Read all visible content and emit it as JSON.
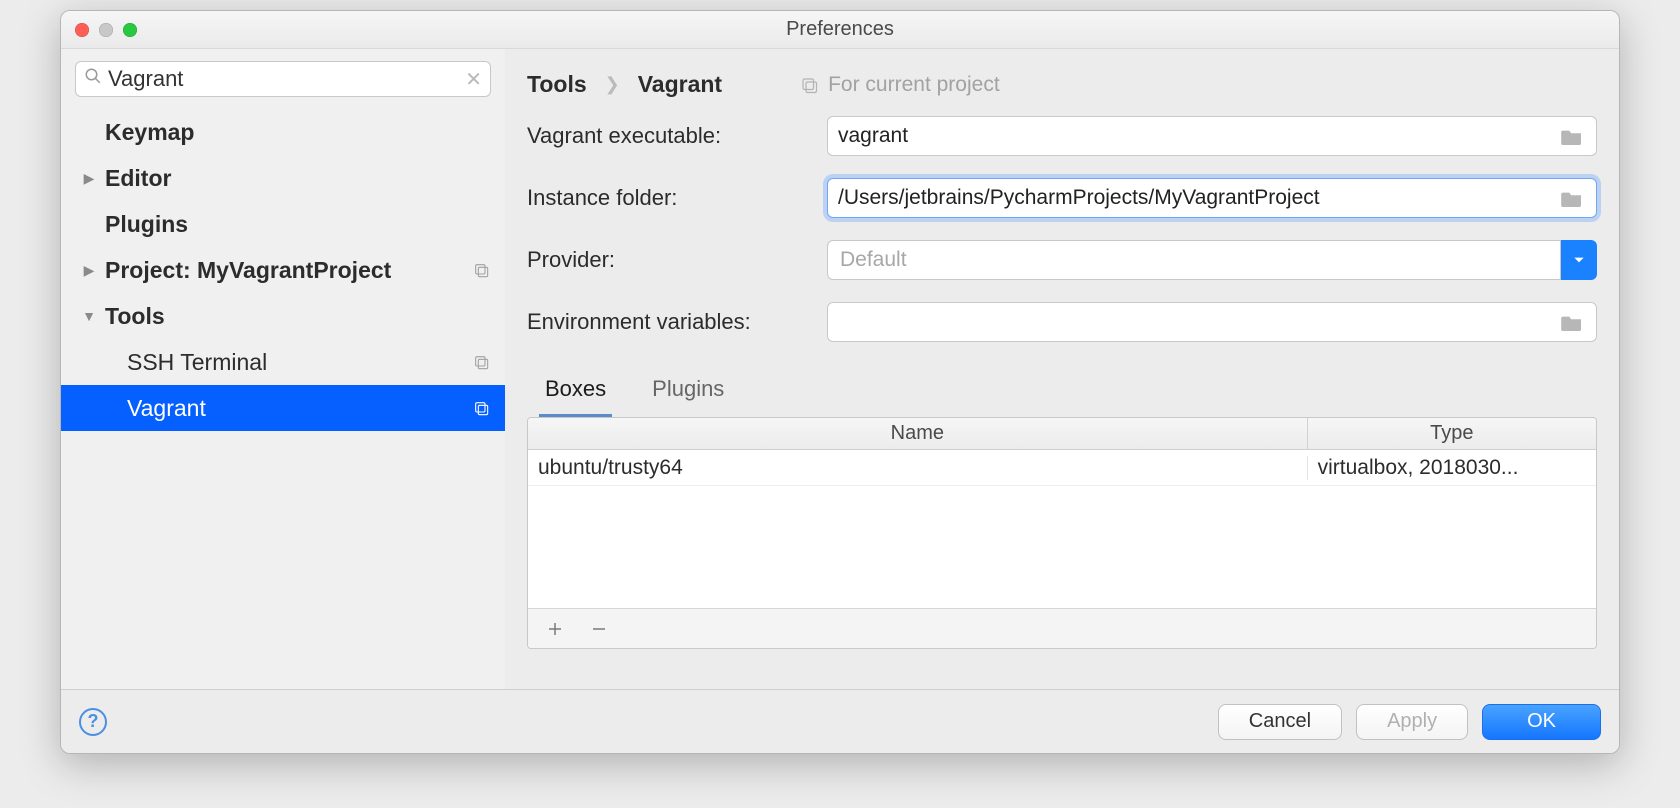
{
  "window": {
    "title": "Preferences"
  },
  "sidebar": {
    "search_value": "Vagrant",
    "items": {
      "keymap": {
        "label": "Keymap"
      },
      "editor": {
        "label": "Editor"
      },
      "plugins": {
        "label": "Plugins"
      },
      "project": {
        "label": "Project: MyVagrantProject"
      },
      "tools": {
        "label": "Tools"
      },
      "ssh": {
        "label": "SSH Terminal"
      },
      "vagrant": {
        "label": "Vagrant"
      }
    }
  },
  "breadcrumb": {
    "root": "Tools",
    "leaf": "Vagrant",
    "scope": "For current project"
  },
  "form": {
    "exe_label": "Vagrant executable:",
    "exe_value": "vagrant",
    "instance_label": "Instance folder:",
    "instance_value": "/Users/jetbrains/PycharmProjects/MyVagrantProject",
    "provider_label": "Provider:",
    "provider_value": "Default",
    "env_label": "Environment variables:",
    "env_value": ""
  },
  "tabs": {
    "boxes": "Boxes",
    "plugins": "Plugins"
  },
  "table": {
    "col_name": "Name",
    "col_type": "Type",
    "rows": [
      {
        "name": "ubuntu/trusty64",
        "type": "virtualbox, 2018030..."
      }
    ]
  },
  "footer": {
    "cancel": "Cancel",
    "apply": "Apply",
    "ok": "OK"
  }
}
